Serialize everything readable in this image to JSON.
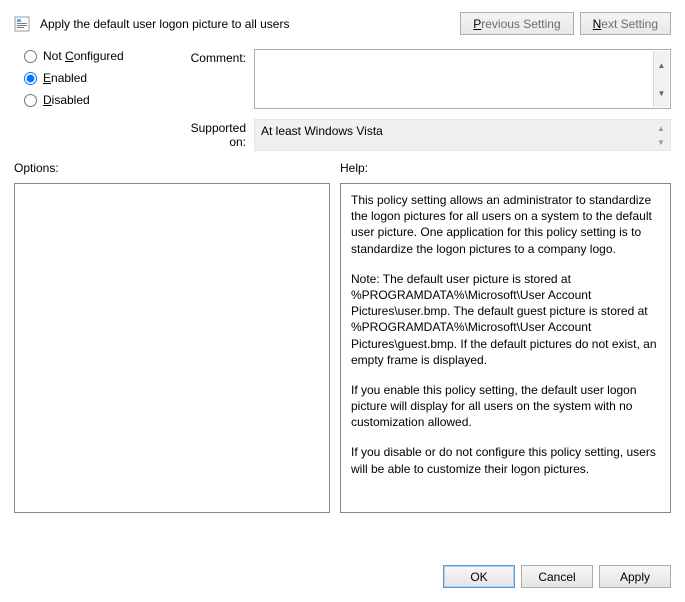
{
  "title": "Apply the default user logon picture to all users",
  "nav": {
    "previous": "Previous Setting",
    "next": "Next Setting"
  },
  "state": {
    "notConfigured": {
      "label": "Not Configured",
      "checked": false
    },
    "enabled": {
      "label": "Enabled",
      "checked": true
    },
    "disabled": {
      "label": "Disabled",
      "checked": false
    }
  },
  "form": {
    "commentLabel": "Comment:",
    "commentValue": "",
    "supportedLabel": "Supported on:",
    "supportedValue": "At least Windows Vista"
  },
  "sections": {
    "options": "Options:",
    "help": "Help:"
  },
  "help": {
    "p1": "This policy setting allows an administrator to standardize the logon pictures for all users on a system to the default user picture. One application for this policy setting is to standardize the logon pictures to a company logo.",
    "p2": "Note: The default user picture is stored at %PROGRAMDATA%\\Microsoft\\User Account Pictures\\user.bmp. The default guest picture is stored at %PROGRAMDATA%\\Microsoft\\User Account Pictures\\guest.bmp. If the default pictures do not exist, an empty frame is displayed.",
    "p3": "If you enable this policy setting, the default user logon picture will display for all users on the system with no customization allowed.",
    "p4": "If you disable or do not configure this policy setting, users will be able to customize their logon pictures."
  },
  "buttons": {
    "ok": "OK",
    "cancel": "Cancel",
    "apply": "Apply"
  },
  "icons": {
    "policy": "policy-icon"
  }
}
